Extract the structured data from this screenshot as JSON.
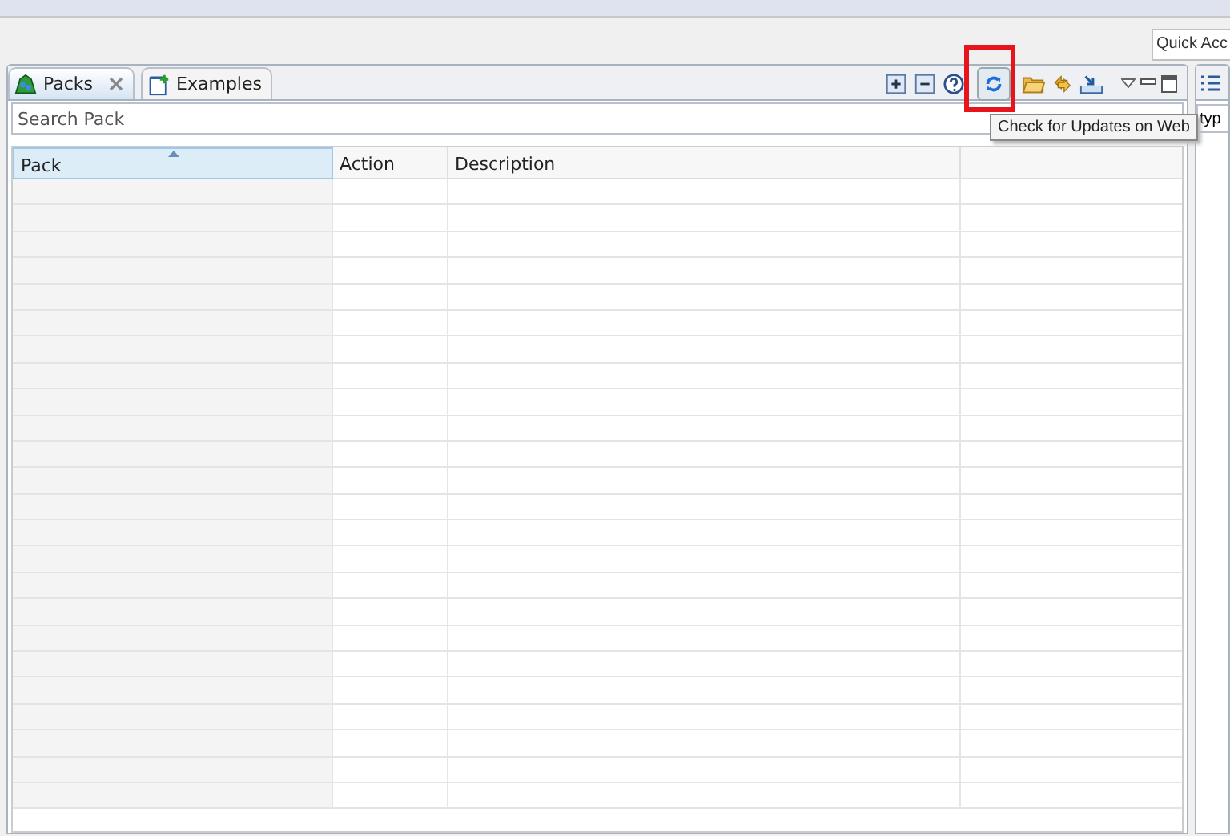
{
  "quick_access": {
    "value": "Quick Acc"
  },
  "tabs": [
    {
      "label": "Packs",
      "selected": true,
      "closable": true
    },
    {
      "label": "Examples",
      "selected": false,
      "closable": false
    }
  ],
  "toolbar": [
    {
      "kind": "expand",
      "hovered": false
    },
    {
      "kind": "collapse",
      "hovered": false
    },
    {
      "kind": "help",
      "hovered": false
    },
    {
      "kind": "refresh",
      "hovered": true
    },
    {
      "kind": "folder",
      "hovered": false
    },
    {
      "kind": "sync",
      "hovered": false
    },
    {
      "kind": "import",
      "hovered": false
    }
  ],
  "highlighted_tool": {
    "tooltip": "Check for Updates on Web"
  },
  "search": {
    "placeholder": "Search Pack"
  },
  "table": {
    "columns": [
      {
        "label": "Pack",
        "sorted": true
      },
      {
        "label": "Action",
        "sorted": false
      },
      {
        "label": "Description",
        "sorted": false
      }
    ]
  },
  "side_panel": {
    "field": {
      "value": "typ"
    }
  }
}
